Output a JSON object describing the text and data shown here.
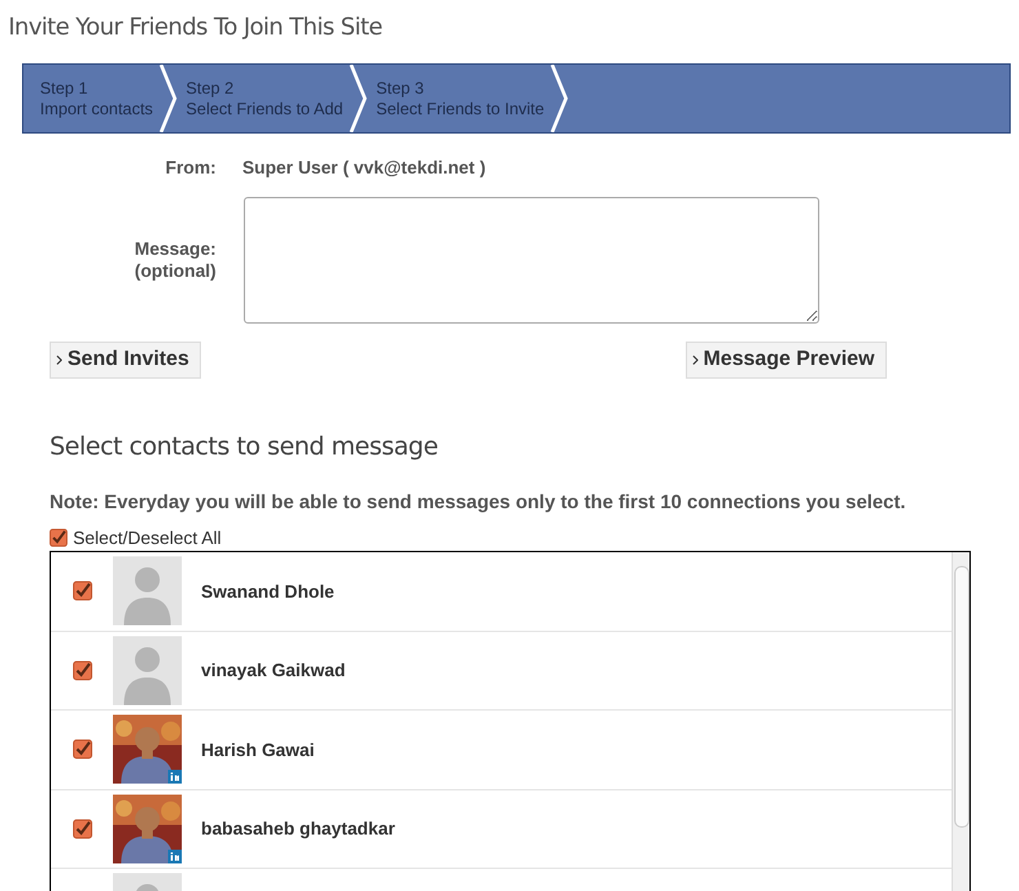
{
  "page_title": "Invite Your Friends To Join This Site",
  "steps": [
    {
      "number": "Step 1",
      "label": "Import contacts"
    },
    {
      "number": "Step 2",
      "label": "Select Friends to Add"
    },
    {
      "number": "Step 3",
      "label": "Select Friends to Invite"
    }
  ],
  "form": {
    "from_label": "From:",
    "from_value": "Super User ( vvk@tekdi.net )",
    "message_label": "Message:",
    "message_hint": "(optional)"
  },
  "buttons": [
    {
      "label": "Send Invites"
    },
    {
      "label": "Message Preview"
    }
  ],
  "section_title": "Select contacts to send message",
  "note": "Note: Everyday you will be able to send messages only to the first 10 connections you select.",
  "select_all": {
    "label": "Select/Deselect All",
    "checked": true
  },
  "contacts": [
    {
      "name": "Swanand Dhole",
      "checked": true,
      "kind": "placeholder"
    },
    {
      "name": "vinayak Gaikwad",
      "checked": true,
      "kind": "placeholder"
    },
    {
      "name": "Harish Gawai",
      "checked": true,
      "kind": "picture"
    },
    {
      "name": "babasaheb ghaytadkar",
      "checked": true,
      "kind": "picture"
    },
    {
      "kind": "placeholder"
    }
  ]
}
